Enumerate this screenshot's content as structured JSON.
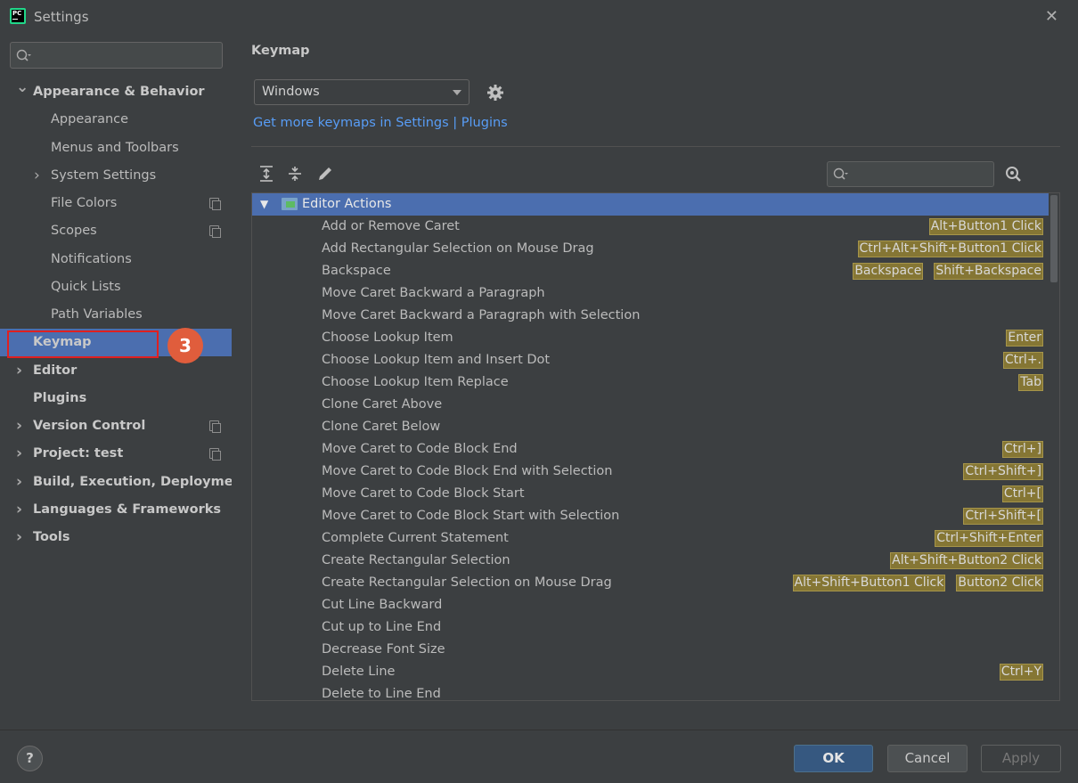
{
  "window": {
    "title": "Settings",
    "app_icon_text": "PC"
  },
  "sidebar": {
    "search_placeholder": "",
    "items": [
      {
        "label": "Appearance & Behavior",
        "bold": true,
        "arrow": "down",
        "indent": 0
      },
      {
        "label": "Appearance",
        "bold": false,
        "arrow": "",
        "indent": 1
      },
      {
        "label": "Menus and Toolbars",
        "bold": false,
        "arrow": "",
        "indent": 1
      },
      {
        "label": "System Settings",
        "bold": false,
        "arrow": "right",
        "indent": 1
      },
      {
        "label": "File Colors",
        "bold": false,
        "arrow": "",
        "indent": 1,
        "cfg": true
      },
      {
        "label": "Scopes",
        "bold": false,
        "arrow": "",
        "indent": 1,
        "cfg": true
      },
      {
        "label": "Notifications",
        "bold": false,
        "arrow": "",
        "indent": 1
      },
      {
        "label": "Quick Lists",
        "bold": false,
        "arrow": "",
        "indent": 1
      },
      {
        "label": "Path Variables",
        "bold": false,
        "arrow": "",
        "indent": 1
      },
      {
        "label": "Keymap",
        "bold": true,
        "arrow": "",
        "indent": 0,
        "selected": true
      },
      {
        "label": "Editor",
        "bold": true,
        "arrow": "right",
        "indent": 0
      },
      {
        "label": "Plugins",
        "bold": true,
        "arrow": "",
        "indent": 0
      },
      {
        "label": "Version Control",
        "bold": true,
        "arrow": "right",
        "indent": 0,
        "cfg": true
      },
      {
        "label": "Project: test",
        "bold": true,
        "arrow": "right",
        "indent": 0,
        "cfg": true
      },
      {
        "label": "Build, Execution, Deployment",
        "bold": true,
        "arrow": "right",
        "indent": 0
      },
      {
        "label": "Languages & Frameworks",
        "bold": true,
        "arrow": "right",
        "indent": 0
      },
      {
        "label": "Tools",
        "bold": true,
        "arrow": "right",
        "indent": 0
      }
    ],
    "step_badge": "3"
  },
  "main": {
    "title": "Keymap",
    "keymap_select": "Windows",
    "more_link": "Get more keymaps in Settings | Plugins",
    "search_placeholder": "",
    "group": "Editor Actions",
    "actions": [
      {
        "name": "Add or Remove Caret",
        "shortcuts": [
          "Alt+Button1 Click"
        ]
      },
      {
        "name": "Add Rectangular Selection on Mouse Drag",
        "shortcuts": [
          "Ctrl+Alt+Shift+Button1 Click"
        ]
      },
      {
        "name": "Backspace",
        "shortcuts": [
          "Backspace",
          "Shift+Backspace"
        ]
      },
      {
        "name": "Move Caret Backward a Paragraph",
        "shortcuts": []
      },
      {
        "name": "Move Caret Backward a Paragraph with Selection",
        "shortcuts": []
      },
      {
        "name": "Choose Lookup Item",
        "shortcuts": [
          "Enter"
        ]
      },
      {
        "name": "Choose Lookup Item and Insert Dot",
        "shortcuts": [
          "Ctrl+."
        ]
      },
      {
        "name": "Choose Lookup Item Replace",
        "shortcuts": [
          "Tab"
        ]
      },
      {
        "name": "Clone Caret Above",
        "shortcuts": []
      },
      {
        "name": "Clone Caret Below",
        "shortcuts": []
      },
      {
        "name": "Move Caret to Code Block End",
        "shortcuts": [
          "Ctrl+]"
        ]
      },
      {
        "name": "Move Caret to Code Block End with Selection",
        "shortcuts": [
          "Ctrl+Shift+]"
        ]
      },
      {
        "name": "Move Caret to Code Block Start",
        "shortcuts": [
          "Ctrl+["
        ]
      },
      {
        "name": "Move Caret to Code Block Start with Selection",
        "shortcuts": [
          "Ctrl+Shift+["
        ]
      },
      {
        "name": "Complete Current Statement",
        "shortcuts": [
          "Ctrl+Shift+Enter"
        ]
      },
      {
        "name": "Create Rectangular Selection",
        "shortcuts": [
          "Alt+Shift+Button2 Click"
        ]
      },
      {
        "name": "Create Rectangular Selection on Mouse Drag",
        "shortcuts": [
          "Alt+Shift+Button1 Click",
          "Button2 Click"
        ]
      },
      {
        "name": "Cut Line Backward",
        "shortcuts": []
      },
      {
        "name": "Cut up to Line End",
        "shortcuts": []
      },
      {
        "name": "Decrease Font Size",
        "shortcuts": []
      },
      {
        "name": "Delete Line",
        "shortcuts": [
          "Ctrl+Y"
        ]
      },
      {
        "name": "Delete to Line End",
        "shortcuts": []
      }
    ]
  },
  "footer": {
    "help_label": "?",
    "ok_label": "OK",
    "cancel_label": "Cancel",
    "apply_label": "Apply"
  },
  "colors": {
    "background": "#3c3f41",
    "selection": "#4b6eaf",
    "link": "#589df6",
    "shortcut_bg": "#857634",
    "badge": "#e05d3c",
    "highlight_box": "#e02020"
  }
}
